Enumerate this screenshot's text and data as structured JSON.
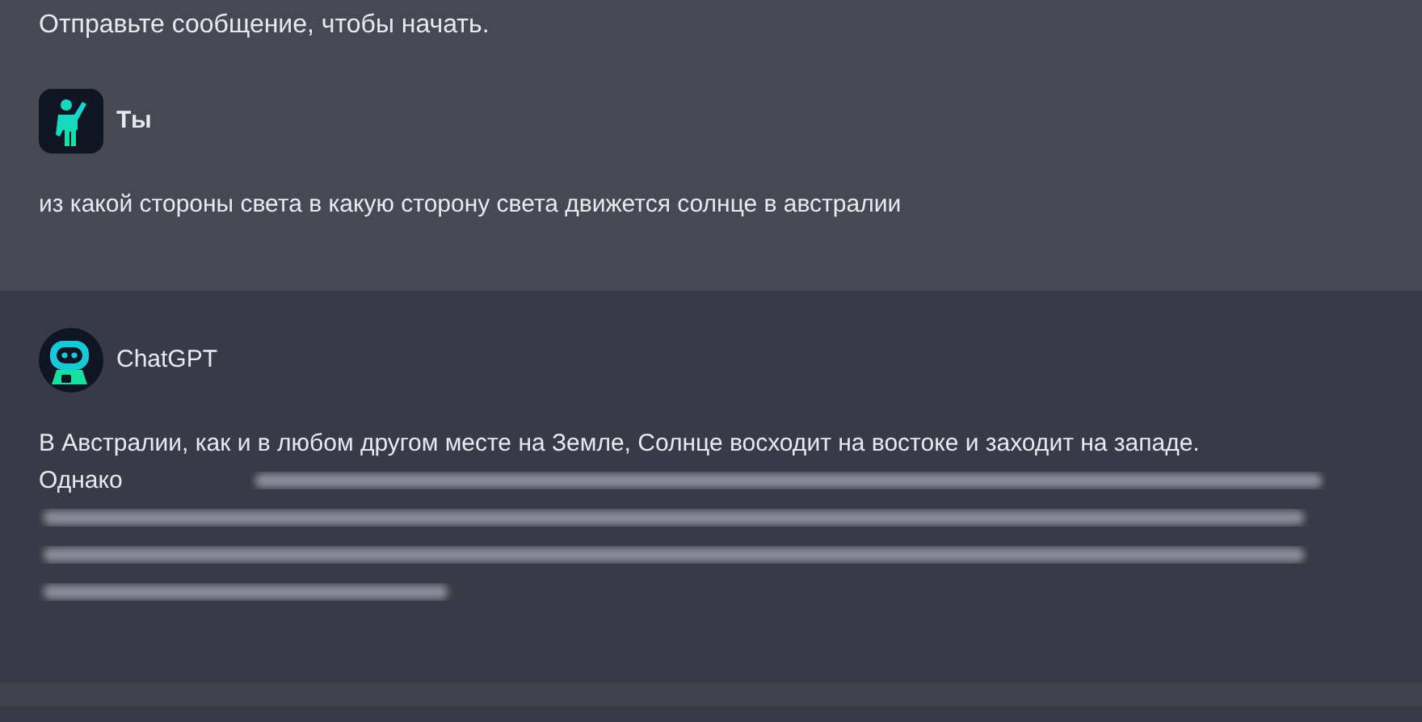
{
  "intro": "Отправьте сообщение, чтобы начать.",
  "messages": [
    {
      "kind": "user",
      "author": "Ты",
      "text": "из какой стороны света в какую сторону света движется солнце в австралии",
      "blurred": false
    },
    {
      "kind": "bot",
      "author": "ChatGPT",
      "text": "В Австралии, как и в любом другом месте на Земле, Солнце восходит на востоке и заходит на западе. Однако",
      "blurred": true
    }
  ]
}
